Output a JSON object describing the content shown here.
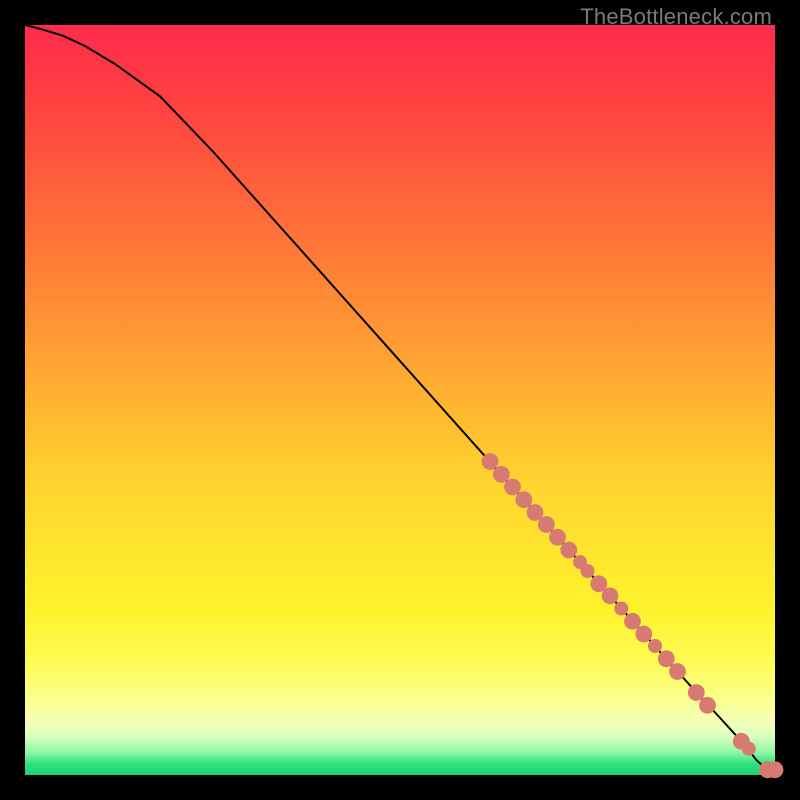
{
  "watermark": "TheBottleneck.com",
  "chart_data": {
    "type": "line",
    "title": "",
    "xlabel": "",
    "ylabel": "",
    "xlim": [
      0,
      100
    ],
    "ylim": [
      0,
      100
    ],
    "grid": false,
    "legend": false,
    "background_gradient": {
      "top": "#ff2a4d",
      "mid": "#ffe52e",
      "bottom": "#19d36b"
    },
    "series": [
      {
        "name": "curve",
        "x": [
          0,
          2,
          5,
          8,
          12,
          18,
          25,
          35,
          45,
          55,
          65,
          72,
          78,
          83,
          87,
          90,
          92.5,
          94.5,
          96,
          97.5,
          99,
          100
        ],
        "y": [
          100,
          99.5,
          98.6,
          97.2,
          94.8,
          90.5,
          83.2,
          72.0,
          60.8,
          49.6,
          38.4,
          30.6,
          23.9,
          18.3,
          13.8,
          10.5,
          7.8,
          5.6,
          4.0,
          2.0,
          0.7,
          0.7
        ]
      }
    ],
    "markers": [
      {
        "x": 62,
        "y": 41.8,
        "r": 1.2
      },
      {
        "x": 63.5,
        "y": 40.1,
        "r": 1.2
      },
      {
        "x": 65,
        "y": 38.4,
        "r": 1.2
      },
      {
        "x": 66.5,
        "y": 36.7,
        "r": 1.2
      },
      {
        "x": 68,
        "y": 35.0,
        "r": 1.2
      },
      {
        "x": 69.5,
        "y": 33.4,
        "r": 1.2
      },
      {
        "x": 71,
        "y": 31.7,
        "r": 1.2
      },
      {
        "x": 72.5,
        "y": 30.0,
        "r": 1.2
      },
      {
        "x": 74,
        "y": 28.4,
        "r": 1.0
      },
      {
        "x": 75,
        "y": 27.2,
        "r": 1.0
      },
      {
        "x": 76.5,
        "y": 25.5,
        "r": 1.2
      },
      {
        "x": 78,
        "y": 23.9,
        "r": 1.2
      },
      {
        "x": 79.5,
        "y": 22.2,
        "r": 1.0
      },
      {
        "x": 81,
        "y": 20.5,
        "r": 1.2
      },
      {
        "x": 82.5,
        "y": 18.8,
        "r": 1.2
      },
      {
        "x": 84,
        "y": 17.2,
        "r": 1.0
      },
      {
        "x": 85.5,
        "y": 15.5,
        "r": 1.2
      },
      {
        "x": 87,
        "y": 13.8,
        "r": 1.2
      },
      {
        "x": 89.5,
        "y": 11.0,
        "r": 1.2
      },
      {
        "x": 91,
        "y": 9.3,
        "r": 1.2
      },
      {
        "x": 95.5,
        "y": 4.5,
        "r": 1.2
      },
      {
        "x": 96.5,
        "y": 3.5,
        "r": 1.0
      },
      {
        "x": 99,
        "y": 0.7,
        "r": 1.2
      },
      {
        "x": 100,
        "y": 0.7,
        "r": 1.2
      }
    ]
  }
}
